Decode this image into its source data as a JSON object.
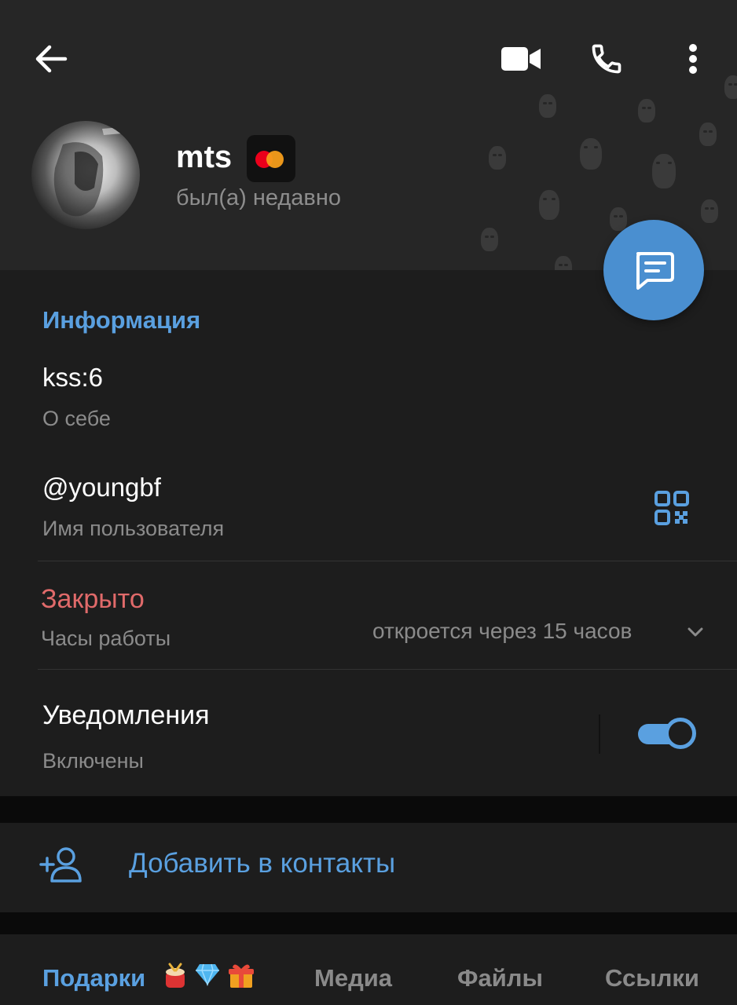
{
  "header": {
    "name": "mts",
    "status": "был(а) недавно"
  },
  "info": {
    "section_title": "Информация",
    "bio_value": "kss:6",
    "bio_label": "О себе",
    "username_value": "@youngbf",
    "username_label": "Имя пользователя",
    "hours_status": "Закрыто",
    "hours_label": "Часы работы",
    "hours_detail": "откроется через 15 часов",
    "notifications_value": "Уведомления",
    "notifications_label": "Включены",
    "notifications_on": true
  },
  "actions": {
    "add_contact": "Добавить в контакты"
  },
  "tabs": [
    {
      "label": "Подарки",
      "active": true
    },
    {
      "label": "Медиа",
      "active": false
    },
    {
      "label": "Файлы",
      "active": false
    },
    {
      "label": "Ссылки",
      "active": false
    }
  ],
  "colors": {
    "accent": "#5aa0e0",
    "closed": "#e06a6a",
    "fab": "#4a8fd0"
  },
  "icons": {
    "back": "arrow-left-icon",
    "video": "video-camera-icon",
    "call": "phone-icon",
    "more": "more-vertical-icon",
    "message": "message-icon",
    "qr": "qr-code-icon",
    "chevron": "chevron-down-icon",
    "add_contact": "add-user-icon",
    "badge": "mastercard-icon",
    "tab_emojis": [
      "drum-icon",
      "gem-icon",
      "gift-icon"
    ]
  }
}
